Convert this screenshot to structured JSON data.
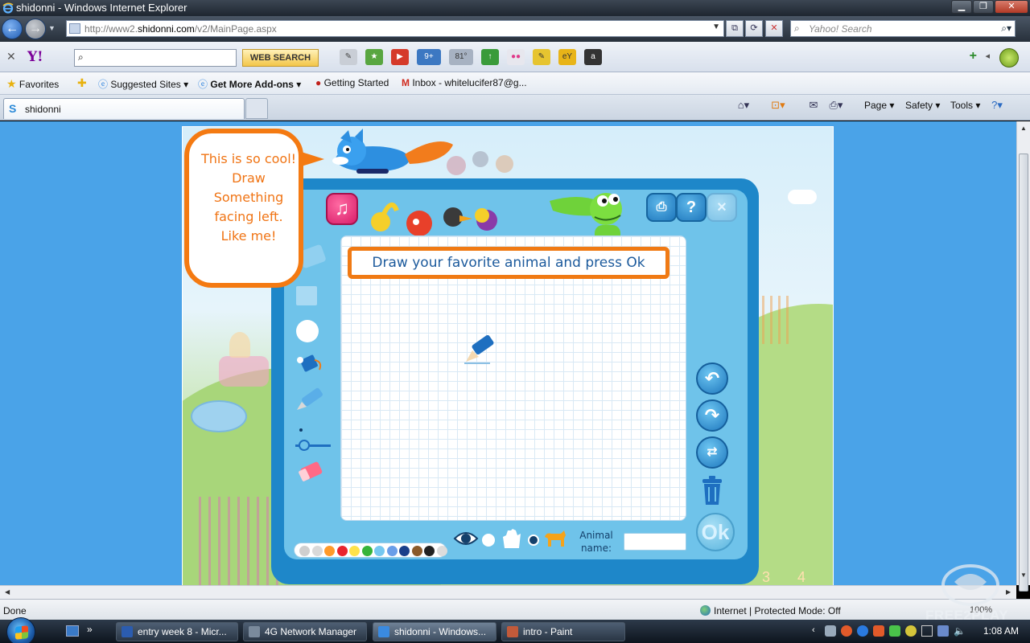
{
  "window": {
    "title": "shidonni - Windows Internet Explorer",
    "controls": [
      "minimize",
      "maximize",
      "close"
    ]
  },
  "address": {
    "url_prefix": "http://www2.",
    "url_domain": "shidonni.com",
    "url_path": "/v2/MainPage.aspx",
    "search_placeholder": "Yahoo! Search"
  },
  "yahoo_toolbar": {
    "logo": "Y!",
    "search_value": "",
    "web_search_label": "WEB SEARCH",
    "mail_badge": "9+",
    "weather_badge": "81°"
  },
  "favorites_bar": {
    "favorites_label": "Favorites",
    "items": [
      {
        "label": "Suggested Sites"
      },
      {
        "label": "Get More Add-ons"
      },
      {
        "label": "Getting Started"
      },
      {
        "label": "Inbox - whitelucifer87@g..."
      }
    ]
  },
  "tabs": {
    "active_label": "shidonni",
    "commands": [
      "Page",
      "Safety",
      "Tools"
    ]
  },
  "game": {
    "bubble_text": [
      "This is so cool!",
      "Draw",
      "Something",
      "facing left.",
      "Like me!"
    ],
    "instruction": "Draw your favorite animal and press Ok",
    "help_label": "?",
    "close_label": "×",
    "ok_label": "Ok",
    "animal_name_label": [
      "Animal",
      "name:"
    ],
    "animal_name_value": "",
    "palette_colors": [
      "#cfcfcf",
      "#d9d9d9",
      "#ff9a2a",
      "#e8242c",
      "#ffe24a",
      "#36b43a",
      "#76c8f0",
      "#6a9ee8",
      "#1a3f8a",
      "#8a5a2a",
      "#222222",
      "#dcdcdc"
    ],
    "ghost_numbers": [
      "3",
      "4"
    ]
  },
  "status": {
    "left": "Done",
    "zone": "Internet | Protected Mode: Off",
    "zoom": "100%"
  },
  "taskbar": {
    "tasks": [
      {
        "label": "entry week 8 - Micr...",
        "color": "#2b5caf"
      },
      {
        "label": "4G Network Manager",
        "color": "#7a8a9c"
      },
      {
        "label": "shidonni - Windows...",
        "color": "#3a8ae0",
        "active": true
      },
      {
        "label": "intro - Paint",
        "color": "#c25a3a"
      }
    ],
    "time": "1:08 AM"
  },
  "watermark": "FREE2PLAY"
}
